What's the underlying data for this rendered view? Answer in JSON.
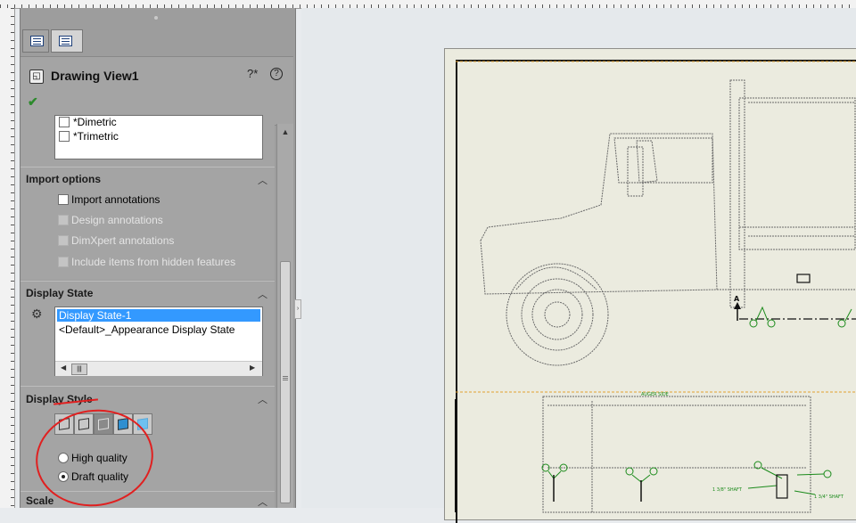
{
  "property_manager": {
    "title": "Drawing View1",
    "icons": {
      "view": "drawing-view-icon",
      "help": "help-icon",
      "question": "question-icon",
      "ok": "ok-checkmark-icon"
    }
  },
  "orientation_list": {
    "items": [
      {
        "label": "*Dimetric",
        "checked": false
      },
      {
        "label": "*Trimetric",
        "checked": false
      }
    ]
  },
  "import_options": {
    "title": "Import options",
    "items": [
      {
        "label": "Import annotations",
        "enabled": true
      },
      {
        "label": "Design annotations",
        "enabled": false
      },
      {
        "label": "DimXpert annotations",
        "enabled": false
      },
      {
        "label": "Include items from hidden features",
        "enabled": false
      }
    ]
  },
  "display_state": {
    "title": "Display State",
    "items": [
      {
        "label": "Display State-1",
        "selected": true
      },
      {
        "label": "<Default>_Appearance Display State",
        "selected": false
      }
    ]
  },
  "display_style": {
    "title": "Display Style",
    "buttons": [
      "wireframe",
      "hidden-lines-visible",
      "hidden-lines-removed",
      "shaded-with-edges",
      "shaded"
    ],
    "selected_button": "hidden-lines-removed",
    "quality_options": [
      {
        "label": "High quality",
        "selected": false
      },
      {
        "label": "Draft quality",
        "selected": true
      }
    ]
  },
  "scale": {
    "title": "Scale"
  },
  "drawing": {
    "labels": {
      "section_a": "A",
      "auger_side": "AUGER SIDE",
      "shaft_left": "1 3/8\" SHAFT",
      "shaft_right": "1 3/4\" SHAFT"
    }
  },
  "colors": {
    "annotation": "#e02020",
    "selection": "#3399ff",
    "weld_symbol": "#1a8a1a",
    "ok_check": "#2c8a2c"
  }
}
